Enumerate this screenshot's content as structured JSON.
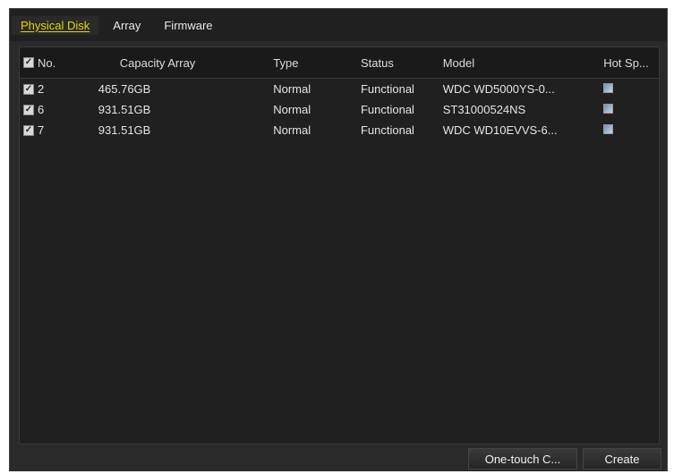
{
  "tabs": [
    {
      "label": "Physical Disk",
      "active": true
    },
    {
      "label": "Array",
      "active": false
    },
    {
      "label": "Firmware",
      "active": false
    }
  ],
  "table": {
    "columns": {
      "no": "No.",
      "capacity": "Capacity Array",
      "type": "Type",
      "status": "Status",
      "model": "Model",
      "hot_spare": "Hot Sp..."
    },
    "rows": [
      {
        "no": "2",
        "capacity": "465.76GB",
        "type": "Normal",
        "status": "Functional",
        "model": "WDC WD5000YS-0...",
        "checked": true
      },
      {
        "no": "6",
        "capacity": "931.51GB",
        "type": "Normal",
        "status": "Functional",
        "model": "ST31000524NS",
        "checked": true
      },
      {
        "no": "7",
        "capacity": "931.51GB",
        "type": "Normal",
        "status": "Functional",
        "model": "WDC WD10EVVS-6...",
        "checked": true
      }
    ]
  },
  "buttons": {
    "one_touch": "One-touch C...",
    "create": "Create"
  },
  "icons": {
    "checkbox": "checkbox-checked-icon",
    "hot_spare": "hot-spare-icon"
  }
}
